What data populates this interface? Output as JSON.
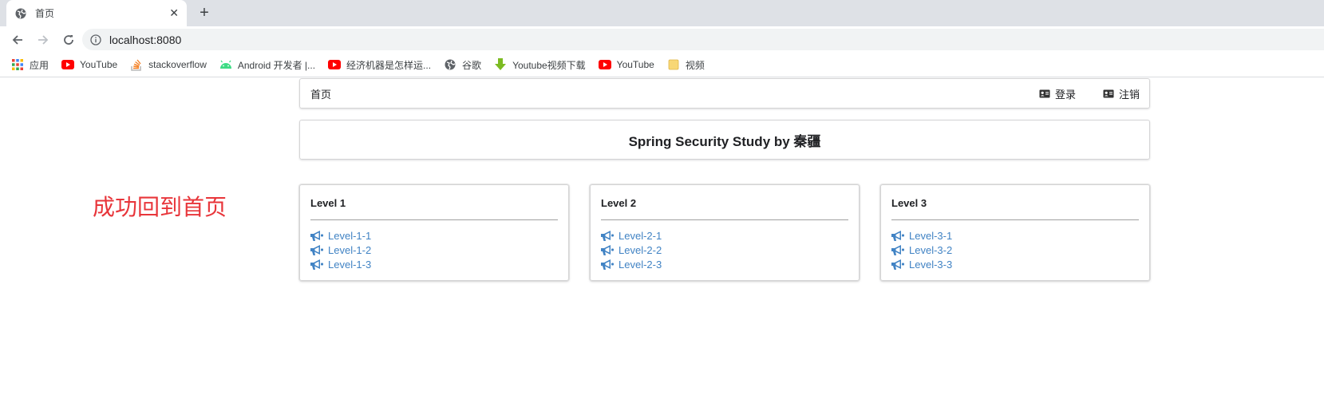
{
  "browser": {
    "tab_title": "首页",
    "url": "localhost:8080",
    "bookmarks": [
      {
        "label": "应用",
        "icon": "apps-grid-icon"
      },
      {
        "label": "YouTube",
        "icon": "youtube-icon"
      },
      {
        "label": "stackoverflow",
        "icon": "stackoverflow-icon"
      },
      {
        "label": "Android 开发者 |...",
        "icon": "android-icon"
      },
      {
        "label": "经济机器是怎样运...",
        "icon": "youtube-icon"
      },
      {
        "label": "谷歌",
        "icon": "globe-icon"
      },
      {
        "label": "Youtube视频下载",
        "icon": "download-arrow-icon"
      },
      {
        "label": "YouTube",
        "icon": "youtube-icon"
      },
      {
        "label": "视频",
        "icon": "folder-icon"
      }
    ]
  },
  "page": {
    "annotation": "成功回到首页",
    "nav": {
      "home": "首页",
      "login": "登录",
      "logout": "注销"
    },
    "header_title": "Spring Security Study by 秦疆",
    "cards": [
      {
        "title": "Level 1",
        "items": [
          "Level-1-1",
          "Level-1-2",
          "Level-1-3"
        ]
      },
      {
        "title": "Level 2",
        "items": [
          "Level-2-1",
          "Level-2-2",
          "Level-2-3"
        ]
      },
      {
        "title": "Level 3",
        "items": [
          "Level-3-1",
          "Level-3-2",
          "Level-3-3"
        ]
      }
    ],
    "link_color": "#4183c4",
    "annotation_color": "#e8353a"
  }
}
